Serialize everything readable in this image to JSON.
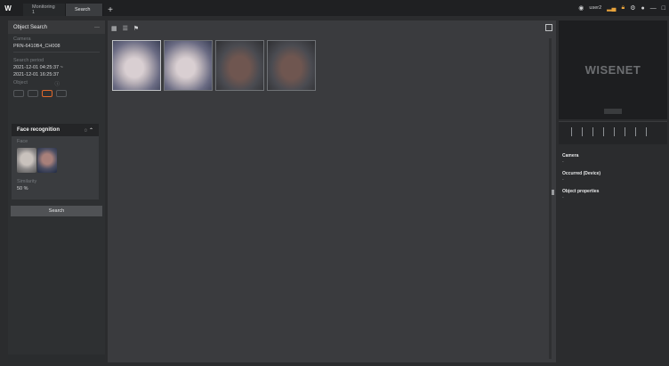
{
  "app": {
    "logo": "W",
    "tabs": [
      {
        "label": "Monitoring 1"
      },
      {
        "label": "Search"
      }
    ],
    "add_tab": "+",
    "user": "user2"
  },
  "left_panel": {
    "title": "Object Search",
    "more": "···",
    "camera_label": "Camera",
    "camera_value": "PRN-6410B4_CH008",
    "period_label": "Search period",
    "period_start": "2021-12-01 04:25:37 ~",
    "period_end": "2021-12-01 16:25:37",
    "object_label": "Object",
    "face_recognition": {
      "title": "Face recognition",
      "face_label": "Face",
      "similarity_label": "Similarity",
      "similarity_value": "50 %"
    },
    "search_button": "Search"
  },
  "center": {
    "results_count": 4
  },
  "right_panel": {
    "video_brand": "WISENET",
    "sections": [
      {
        "title": "Camera",
        "value": "-"
      },
      {
        "title": "Occurred (Device)",
        "value": "-"
      },
      {
        "title": "Object properties",
        "value": "-"
      }
    ]
  },
  "colors": {
    "accent": "#e0692c",
    "lock": "#e8a33b"
  }
}
